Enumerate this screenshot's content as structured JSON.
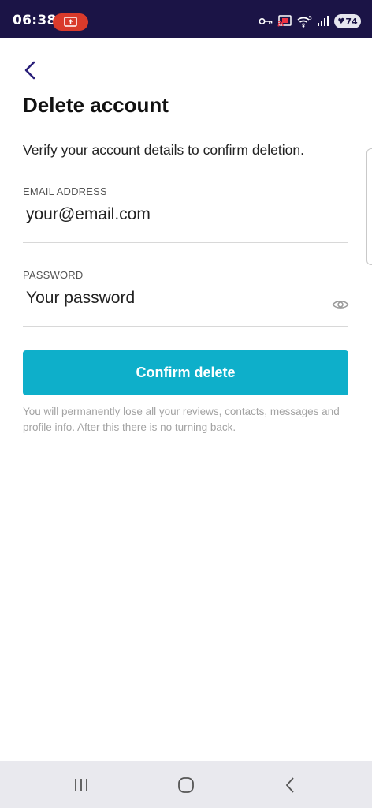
{
  "status_bar": {
    "time": "06:38",
    "battery_level": "74",
    "background": "#1b1446",
    "record_pill_color": "#d93a2b",
    "icons": [
      "screen-record-icon",
      "key-icon",
      "cast-icon",
      "wifi-icon",
      "signal-icon",
      "battery-icon"
    ]
  },
  "header": {
    "back_icon": "chevron-left-icon",
    "title": "Delete account"
  },
  "intro": {
    "text": "Verify your account details to confirm deletion."
  },
  "form": {
    "email": {
      "label": "EMAIL ADDRESS",
      "placeholder": "your@email.com",
      "value": ""
    },
    "password": {
      "label": "PASSWORD",
      "placeholder": "Your password",
      "value": "",
      "toggle_icon": "eye-icon"
    }
  },
  "confirm_button": {
    "label": "Confirm delete",
    "color": "#0eafca"
  },
  "warning": {
    "text": "You will permanently lose all your reviews, contacts, messages and profile info. After this there is no turning back."
  },
  "nav_bar": {
    "icons": [
      "recent-apps-icon",
      "home-icon",
      "back-icon"
    ]
  }
}
